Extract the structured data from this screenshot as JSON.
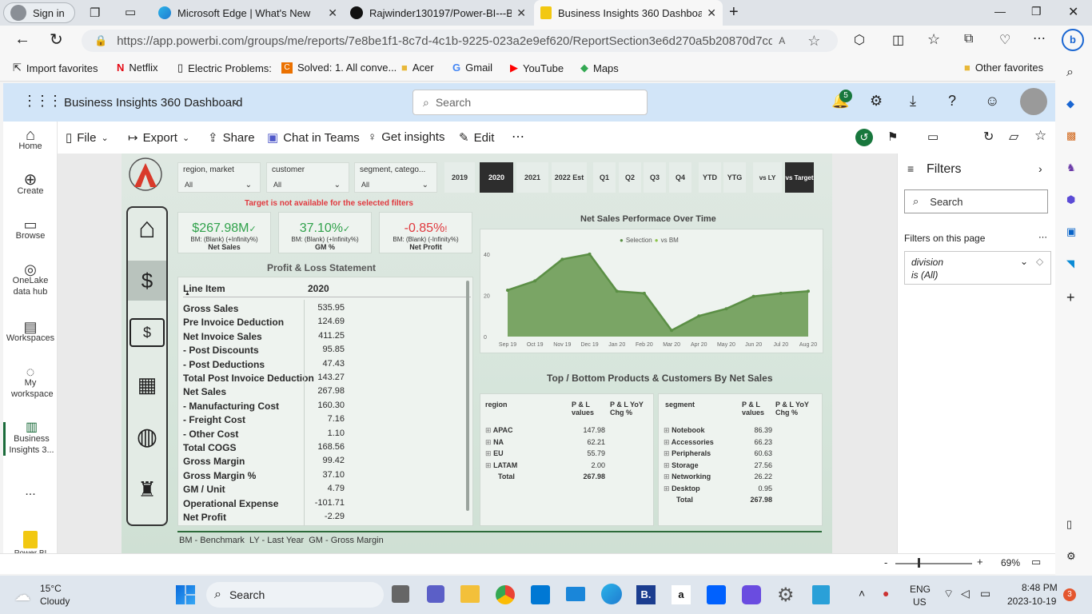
{
  "browser": {
    "tabs": [
      {
        "label": "Sign in"
      },
      {
        "label": "Microsoft Edge | What's New"
      },
      {
        "label": "Rajwinder130197/Power-BI---Bu"
      },
      {
        "label": "Business Insights 360 Dashboard"
      }
    ],
    "url": "https://app.powerbi.com/groups/me/reports/7e8be1f1-8c7d-4c1b-9225-023a2e9ef620/ReportSection3e6d270a5b20870d7cd8?ex...",
    "favorites": [
      "Import favorites",
      "Netflix",
      "Electric Problems:",
      "Solved: 1. All conve...",
      "Acer",
      "Gmail",
      "YouTube",
      "Maps"
    ],
    "other_favorites": "Other favorites"
  },
  "pbi": {
    "title": "Business Insights 360 Dashboard",
    "search_placeholder": "Search",
    "notification_count": "5",
    "nav": [
      {
        "label": "Home"
      },
      {
        "label": "Create"
      },
      {
        "label": "Browse"
      },
      {
        "label": "OneLake data hub"
      },
      {
        "label": "Workspaces"
      },
      {
        "label": "My workspace"
      },
      {
        "label": "Business Insights 3..."
      }
    ],
    "nav_more": "...",
    "brand": "Power BI",
    "commands": [
      "File",
      "Export",
      "Share",
      "Chat in Teams",
      "Get insights",
      "Edit"
    ],
    "zoom": "69%"
  },
  "report": {
    "slicers": [
      {
        "label": "region, market",
        "value": "All"
      },
      {
        "label": "customer",
        "value": "All"
      },
      {
        "label": "segment, catego...",
        "value": "All"
      }
    ],
    "periods": [
      "2019",
      "2020",
      "2021",
      "2022 Est",
      "Q1",
      "Q2",
      "Q3",
      "Q4",
      "YTD",
      "YTG",
      "vs LY",
      "vs Target"
    ],
    "selected_period": "2020",
    "warning": "Target is not available for the selected filters",
    "kpis": [
      {
        "value": "$267.98M",
        "bm": "BM: (Blank) (+Infinity%)",
        "name": "Net Sales",
        "mark": "✓"
      },
      {
        "value": "37.10%",
        "bm": "BM: (Blank) (+Infinity%)",
        "name": "GM %",
        "mark": "✓"
      },
      {
        "value": "-0.85%",
        "bm": "BM: (Blank) (-Infinity%)",
        "name": "Net Profit",
        "mark": "!"
      }
    ],
    "pl_title": "Profit & Loss Statement",
    "pl_header": {
      "item": "Line Item",
      "year": "2020"
    },
    "pl_rows": [
      {
        "item": "Gross Sales",
        "value": "535.95"
      },
      {
        "item": "Pre Invoice Deduction",
        "value": "124.69"
      },
      {
        "item": "Net Invoice Sales",
        "value": "411.25"
      },
      {
        "item": "- Post Discounts",
        "value": "95.85"
      },
      {
        "item": "- Post Deductions",
        "value": "47.43"
      },
      {
        "item": "Total Post Invoice Deduction",
        "value": "143.27"
      },
      {
        "item": "Net Sales",
        "value": "267.98"
      },
      {
        "item": "- Manufacturing Cost",
        "value": "160.30"
      },
      {
        "item": "- Freight Cost",
        "value": "7.16"
      },
      {
        "item": "- Other Cost",
        "value": "1.10"
      },
      {
        "item": "Total COGS",
        "value": "168.56"
      },
      {
        "item": "Gross Margin",
        "value": "99.42"
      },
      {
        "item": "Gross Margin %",
        "value": "37.10"
      },
      {
        "item": "GM / Unit",
        "value": "4.79"
      },
      {
        "item": "Operational Expense",
        "value": "-101.71"
      },
      {
        "item": "Net Profit",
        "value": "-2.29"
      }
    ],
    "chart_title": "Net Sales Performace Over Time",
    "legend": [
      "Selection",
      "vs BM"
    ],
    "tb_title": "Top / Bottom Products & Customers By Net Sales",
    "region_table": {
      "headers": [
        "region",
        "P & L values",
        "P & L YoY Chg %"
      ],
      "rows": [
        [
          "APAC",
          "147.98"
        ],
        [
          "NA",
          "62.21"
        ],
        [
          "EU",
          "55.79"
        ],
        [
          "LATAM",
          "2.00"
        ]
      ],
      "total": [
        "Total",
        "267.98"
      ]
    },
    "segment_table": {
      "headers": [
        "segment",
        "P & L values",
        "P & L YoY Chg %"
      ],
      "rows": [
        [
          "Notebook",
          "86.39"
        ],
        [
          "Accessories",
          "66.23"
        ],
        [
          "Peripherals",
          "60.63"
        ],
        [
          "Storage",
          "27.56"
        ],
        [
          "Networking",
          "26.22"
        ],
        [
          "Desktop",
          "0.95"
        ]
      ],
      "total": [
        "Total",
        "267.98"
      ]
    },
    "footer": "BM - Benchmark  LY - Last Year  GM - Gross Margin"
  },
  "filters": {
    "title": "Filters",
    "search_placeholder": "Search",
    "section": "Filters on this page",
    "card_line1": "division",
    "card_line2": "is (All)"
  },
  "taskbar": {
    "weather_temp": "15°C",
    "weather_desc": "Cloudy",
    "search_placeholder": "Search",
    "lang1": "ENG",
    "lang2": "US",
    "time": "8:48 PM",
    "date": "2023-10-19",
    "badge": "3"
  },
  "chart_data": {
    "type": "area",
    "title": "Net Sales Performace Over Time",
    "categories": [
      "Sep 19",
      "Oct 19",
      "Nov 19",
      "Dec 19",
      "Jan 20",
      "Feb 20",
      "Mar 20",
      "Apr 20",
      "May 20",
      "Jun 20",
      "Jul 20",
      "Aug 20"
    ],
    "series": [
      {
        "name": "Selection",
        "values": [
          22.5,
          27,
          37.5,
          40,
          22,
          21,
          3,
          10,
          13.5,
          19.5,
          21,
          22
        ]
      }
    ],
    "yticks": [
      "0",
      "20",
      "40"
    ],
    "ylim": [
      0,
      45
    ],
    "grid": false,
    "legend": "top"
  },
  "colors": {
    "accent": "#5b8f45",
    "fill": "#7aa565",
    "pos": "#2fa14a",
    "neg": "#e0393e"
  }
}
